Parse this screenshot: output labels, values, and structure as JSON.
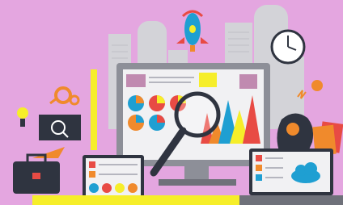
{
  "scene": {
    "description_free": true,
    "palette": {
      "background": "#e4a6e0",
      "city": "#d3d3d8",
      "monitor_frame": "#8d8f98",
      "screen": "#f1f1f3",
      "accent_yellow": "#f6ee2a",
      "accent_orange": "#f08a2c",
      "accent_blue": "#1f9fd2",
      "accent_red": "#e84b44",
      "dark": "#2f3440"
    },
    "icons": [
      "rocket-icon",
      "clock-icon",
      "gear-icon",
      "lightbulb-icon",
      "briefcase-icon",
      "magnifier-icon",
      "head-profile-icon",
      "cloud-icon",
      "pie-chart-icon",
      "bar-chart-icon"
    ]
  }
}
